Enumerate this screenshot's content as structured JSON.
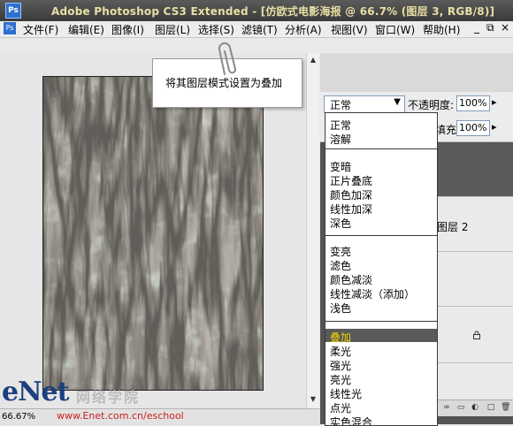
{
  "window": {
    "title": "Adobe Photoshop CS3 Extended - [仿欧式电影海报 @ 66.7% (图层 3, RGB/8)]",
    "app_icon_text": "Ps"
  },
  "menubar": {
    "items": [
      "文件(F)",
      "编辑(E)",
      "图像(I)",
      "图层(L)",
      "选择(S)",
      "滤镜(T)",
      "分析(A)",
      "视图(V)",
      "窗口(W)",
      "帮助(H)"
    ],
    "window_controls": [
      "_",
      "⧉",
      "×"
    ]
  },
  "callout": {
    "text": "将其图层模式设置为叠加"
  },
  "layers_panel": {
    "blend_mode": "正常",
    "opacity_label": "不透明度:",
    "opacity_value": "100%",
    "fill_label": "填充:",
    "fill_value": "100%",
    "layer_name": "图层 2"
  },
  "blend_dropdown": {
    "groups": [
      [
        "正常",
        "溶解"
      ],
      [
        "变暗",
        "正片叠底",
        "颜色加深",
        "线性加深",
        "深色"
      ],
      [
        "变亮",
        "滤色",
        "颜色减淡",
        "线性减淡（添加）",
        "浅色"
      ],
      [
        "叠加",
        "柔光",
        "强光",
        "亮光",
        "线性光",
        "点光",
        "实色混合"
      ]
    ],
    "selected": "叠加",
    "selected_color": "#f2d000"
  },
  "status": {
    "zoom": "66.67%"
  },
  "watermark": {
    "brand": "eNet",
    "chinese": "网络学院",
    "url": "www.Enet.com.cn/eschool"
  },
  "colors": {
    "title_text": "#e8dfa4",
    "titlebar": "#4a4a4a",
    "panel_dark": "#545454",
    "watermark_url": "#c82020"
  }
}
